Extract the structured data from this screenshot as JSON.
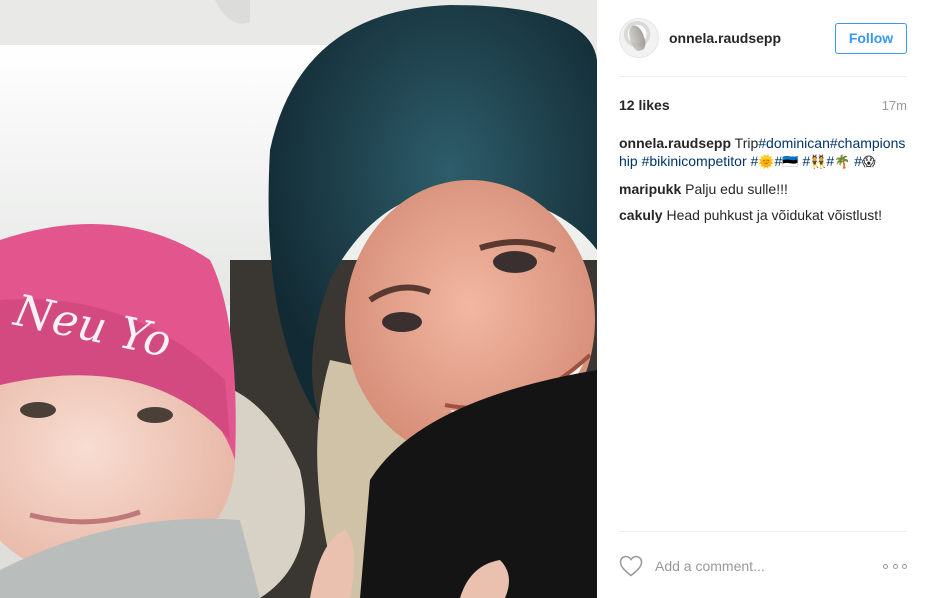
{
  "photo": {
    "alt": "",
    "beanie_text": "Neu Yo"
  },
  "header": {
    "username": "onnela.raudsepp",
    "follow_label": "Follow"
  },
  "stats": {
    "likes": "12 likes",
    "time": "17m"
  },
  "caption": {
    "author": "onnela.raudsepp",
    "text": "Trip",
    "tags": [
      "#dominican",
      "#championship",
      "#bikinicompetitor"
    ],
    "tail_1": "#",
    "emoji_1": "🌞",
    "tail_2": "#",
    "emoji_2": "🇪🇪",
    "tail_3": " #",
    "emoji_3": "👯",
    "tail_4": "#",
    "emoji_4": "🌴",
    "tail_5": "#",
    "emoji_5": "😱"
  },
  "comments": [
    {
      "author": "maripukk",
      "text": "Palju edu sulle!!!"
    },
    {
      "author": "cakuly",
      "text": "Head puhkust ja võidukat võistlust!"
    }
  ],
  "footer": {
    "comment_placeholder": "Add a comment..."
  },
  "colors": {
    "link": "#003569",
    "follow": "#3897f0",
    "muted": "#999999"
  },
  "icons": {
    "like": "heart-outline-icon",
    "more": "more-options-icon"
  }
}
